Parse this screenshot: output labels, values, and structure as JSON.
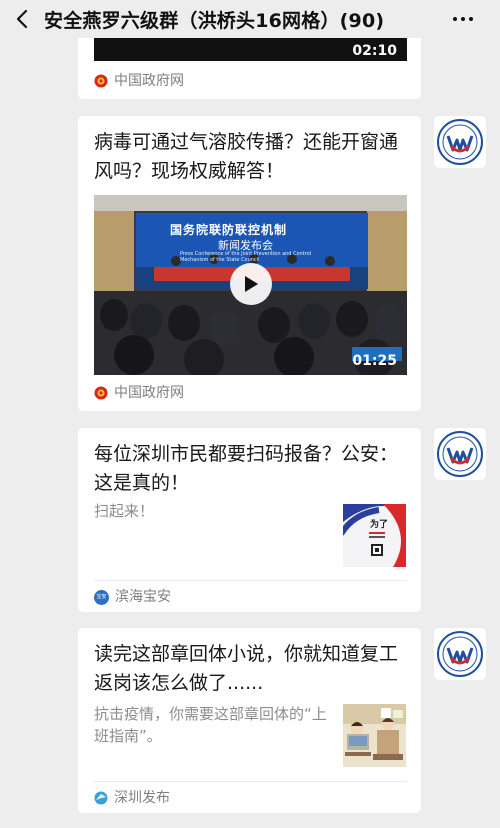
{
  "header": {
    "title": "安全燕罗六级群（洪桥头16网格）(90)"
  },
  "messages": [
    {
      "source": "中国政府网",
      "duration": "02:10"
    },
    {
      "title": "病毒可通过气溶胶传播？还能开窗通风吗？现场权威解答！",
      "video_banner_line1": "国务院联防联控机制",
      "video_banner_line2": "新闻发布会",
      "video_banner_en": "Press Conference of the Joint Prevention and Control Mechanism of the State Council",
      "duration": "01:25",
      "source": "中国政府网"
    },
    {
      "title": "每位深圳市民都要扫码报备？公安：这是真的！",
      "description": "扫起来！",
      "thumb_text": "为了",
      "source": "滨海宝安",
      "source_icon_text": "宝安"
    },
    {
      "title": "读完这部章回体小说，你就知道复工返岗该怎么做了......",
      "description": "抗击疫情，你需要这部章回体的“上班指南”。",
      "source": "深圳发布"
    }
  ],
  "icons": {
    "back": "chevron-left-icon",
    "more": "more-dots-icon",
    "gov": "national-emblem-icon",
    "baoan": "baoan-logo-icon",
    "shenzhen": "shenzhen-release-icon",
    "avatar": "group-member-avatar"
  },
  "colors": {
    "background": "#ededed",
    "card": "#ffffff",
    "source_text": "#7f7f7f",
    "avatar_blue": "#1f4e9c",
    "avatar_red": "#d92b2b"
  }
}
